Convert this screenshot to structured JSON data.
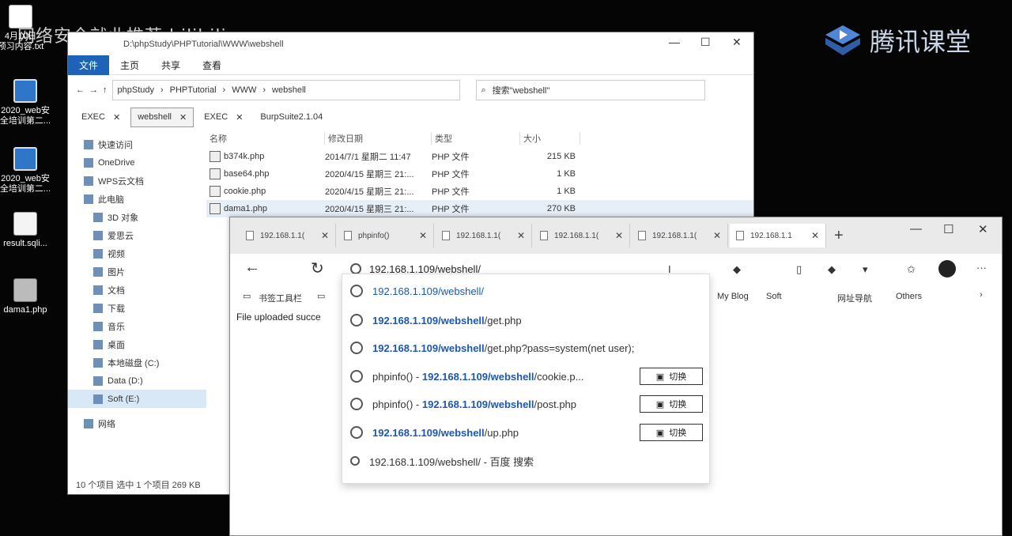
{
  "desktop": {
    "watermark_left": "网络安全就业推荐 bilibili",
    "brand_name": "腾讯课堂",
    "icons": [
      {
        "label": "4月10日\n预习内容.txt",
        "icon": "text-file-icon"
      },
      {
        "label": "2020_web安\n全培训第二...",
        "icon": "computer-icon"
      },
      {
        "label": "2020_web安\n全培训第二...",
        "icon": "computer-icon"
      },
      {
        "label": "result.sqli...",
        "icon": "file-icon"
      },
      {
        "label": "dama1.php",
        "icon": "php-file-icon"
      }
    ]
  },
  "explorer": {
    "title": "D:\\phpStudy\\PHPTutorial\\WWW\\webshell",
    "ribbon_tabs": [
      "文件",
      "主页",
      "共享",
      "查看"
    ],
    "breadcrumb": [
      "phpStudy",
      "PHPTutorial",
      "WWW",
      "webshell"
    ],
    "search_placeholder": "搜索\"webshell\"",
    "tabs": [
      "EXEC",
      "webshell",
      "EXEC",
      "BurpSuite2.1.04"
    ],
    "nav_items": [
      "快速访问",
      "OneDrive",
      "WPS云文档",
      "此电脑",
      "3D 对象",
      "爱思云",
      "视频",
      "图片",
      "文档",
      "下载",
      "音乐",
      "桌面",
      "本地磁盘 (C:)",
      "Data (D:)",
      "Soft (E:)",
      "网络"
    ],
    "columns": [
      "名称",
      "修改日期",
      "类型",
      "大小"
    ],
    "files": [
      {
        "name": "b374k.php",
        "date": "2014/7/1 星期二 11:47",
        "type": "PHP 文件",
        "size": "215 KB"
      },
      {
        "name": "base64.php",
        "date": "2020/4/15 星期三 21:...",
        "type": "PHP 文件",
        "size": "1 KB"
      },
      {
        "name": "cookie.php",
        "date": "2020/4/15 星期三 21:...",
        "type": "PHP 文件",
        "size": "1 KB"
      },
      {
        "name": "dama1.php",
        "date": "2020/4/15 星期三 21:...",
        "type": "PHP 文件",
        "size": "270 KB"
      }
    ],
    "status": "10 个项目  选中 1 个项目  269 KB"
  },
  "browser": {
    "tabs": [
      "192.168.1.1(",
      "phpinfo()",
      "192.168.1.1(",
      "192.168.1.1(",
      "192.168.1.1(",
      "192.168.1.1"
    ],
    "address_value": "192.168.1.109/webshell/",
    "bookmarks_left": [
      "书签工具栏"
    ],
    "bookmarks_right": [
      "My Blog",
      "Soft",
      "网址导航",
      "Others"
    ],
    "page_message": "File uploaded succe",
    "suggestions": [
      {
        "prefix": "",
        "url_bold": "192.168.1.109/webshell",
        "url_rest": "/",
        "has_switch": false,
        "icon": "globe-icon"
      },
      {
        "prefix": "",
        "url_bold": "192.168.1.109/webshell",
        "url_rest": "/get.php",
        "has_switch": false,
        "icon": "globe-icon"
      },
      {
        "prefix": "",
        "url_bold": "192.168.1.109/webshell",
        "url_rest": "/get.php?pass=system(net user);",
        "has_switch": false,
        "icon": "globe-icon"
      },
      {
        "prefix": "phpinfo() - ",
        "url_bold": "192.168.1.109/webshell",
        "url_rest": "/cookie.p...",
        "has_switch": true,
        "icon": "globe-icon"
      },
      {
        "prefix": "phpinfo() - ",
        "url_bold": "192.168.1.109/webshell",
        "url_rest": "/post.php",
        "has_switch": true,
        "icon": "globe-icon"
      },
      {
        "prefix": "",
        "url_bold": "192.168.1.109/webshell",
        "url_rest": "/up.php",
        "has_switch": true,
        "icon": "globe-icon"
      },
      {
        "prefix": "",
        "url_bold": "192.168.1.109/webshell/",
        "url_rest": " - 百度 搜索",
        "has_switch": false,
        "icon": "search-icon"
      }
    ],
    "switch_label": "切换"
  }
}
